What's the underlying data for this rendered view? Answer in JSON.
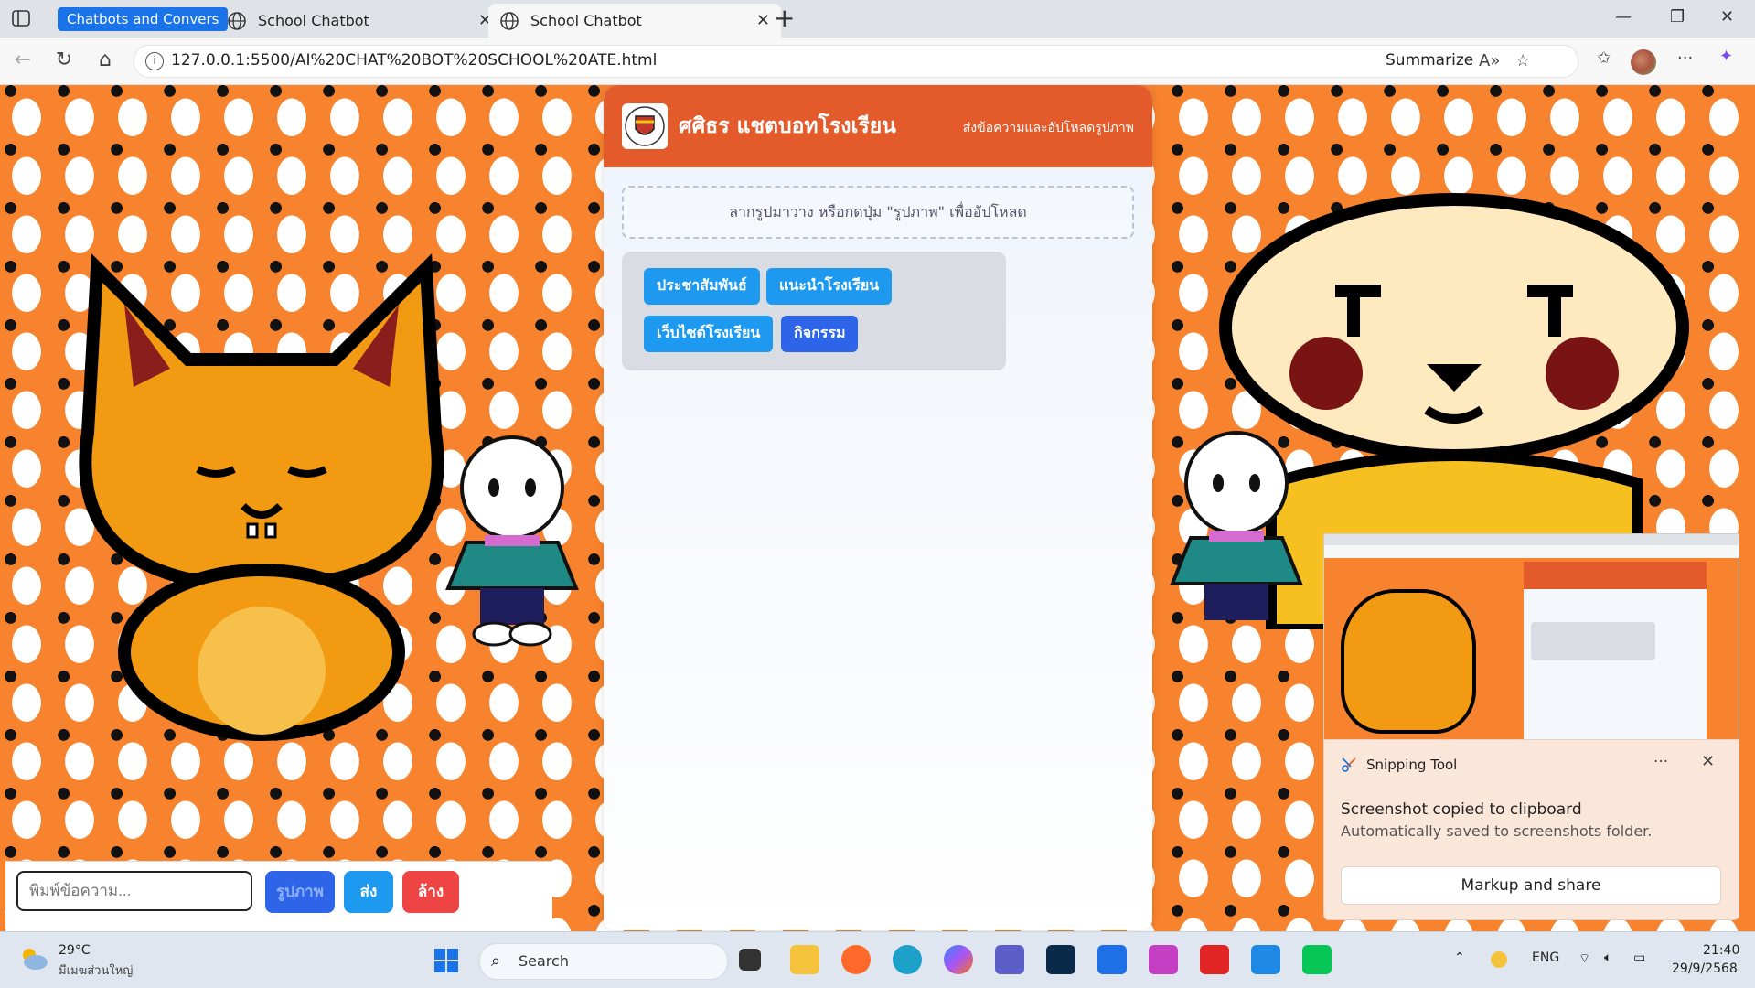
{
  "browser": {
    "tab_group_label": "Chatbots and Convers",
    "tabs": [
      {
        "title": "School Chatbot"
      },
      {
        "title": "School Chatbot"
      }
    ],
    "url": "127.0.0.1:5500/AI%20CHAT%20BOT%20SCHOOL%20ATE.html",
    "summarize_label": "Summarize"
  },
  "chat": {
    "title": "ศศิธร แชตบอทโรงเรียน",
    "subtitle": "ส่งข้อความและอัปโหลดรูปภาพ",
    "dropzone_text": "ลากรูปมาวาง หรือกดปุ่ม \"รูปภาพ\" เพื่ออัปโหลด",
    "quick_buttons": [
      {
        "label": "ประชาสัมพันธ์"
      },
      {
        "label": "แนะนำโรงเรียน"
      },
      {
        "label": "เว็บไซต์โรงเรียน"
      },
      {
        "label": "กิจกรรม"
      }
    ],
    "input_placeholder": "พิมพ์ข้อความ...",
    "image_button": "รูปภาพ",
    "send_button": "ส่ง",
    "clear_button": "ล้าง"
  },
  "snipping": {
    "app_name": "Snipping Tool",
    "title": "Screenshot copied to clipboard",
    "description": "Automatically saved to screenshots folder.",
    "action": "Markup and share",
    "more": "···",
    "close": "✕"
  },
  "taskbar": {
    "temperature": "29°C",
    "weather_desc": "มีเมฆส่วนใหญ่",
    "search_placeholder": "Search",
    "language": "ENG",
    "time": "21:40",
    "date": "29/9/2568"
  },
  "colors": {
    "header": "#e35b2b",
    "quick_button": "#1d9af0",
    "quick_button_alt": "#2d64e8",
    "send": "#1d9af0",
    "clear": "#ef4444",
    "image_btn": "#2d64e8",
    "tab_group": "#1a73e8"
  }
}
